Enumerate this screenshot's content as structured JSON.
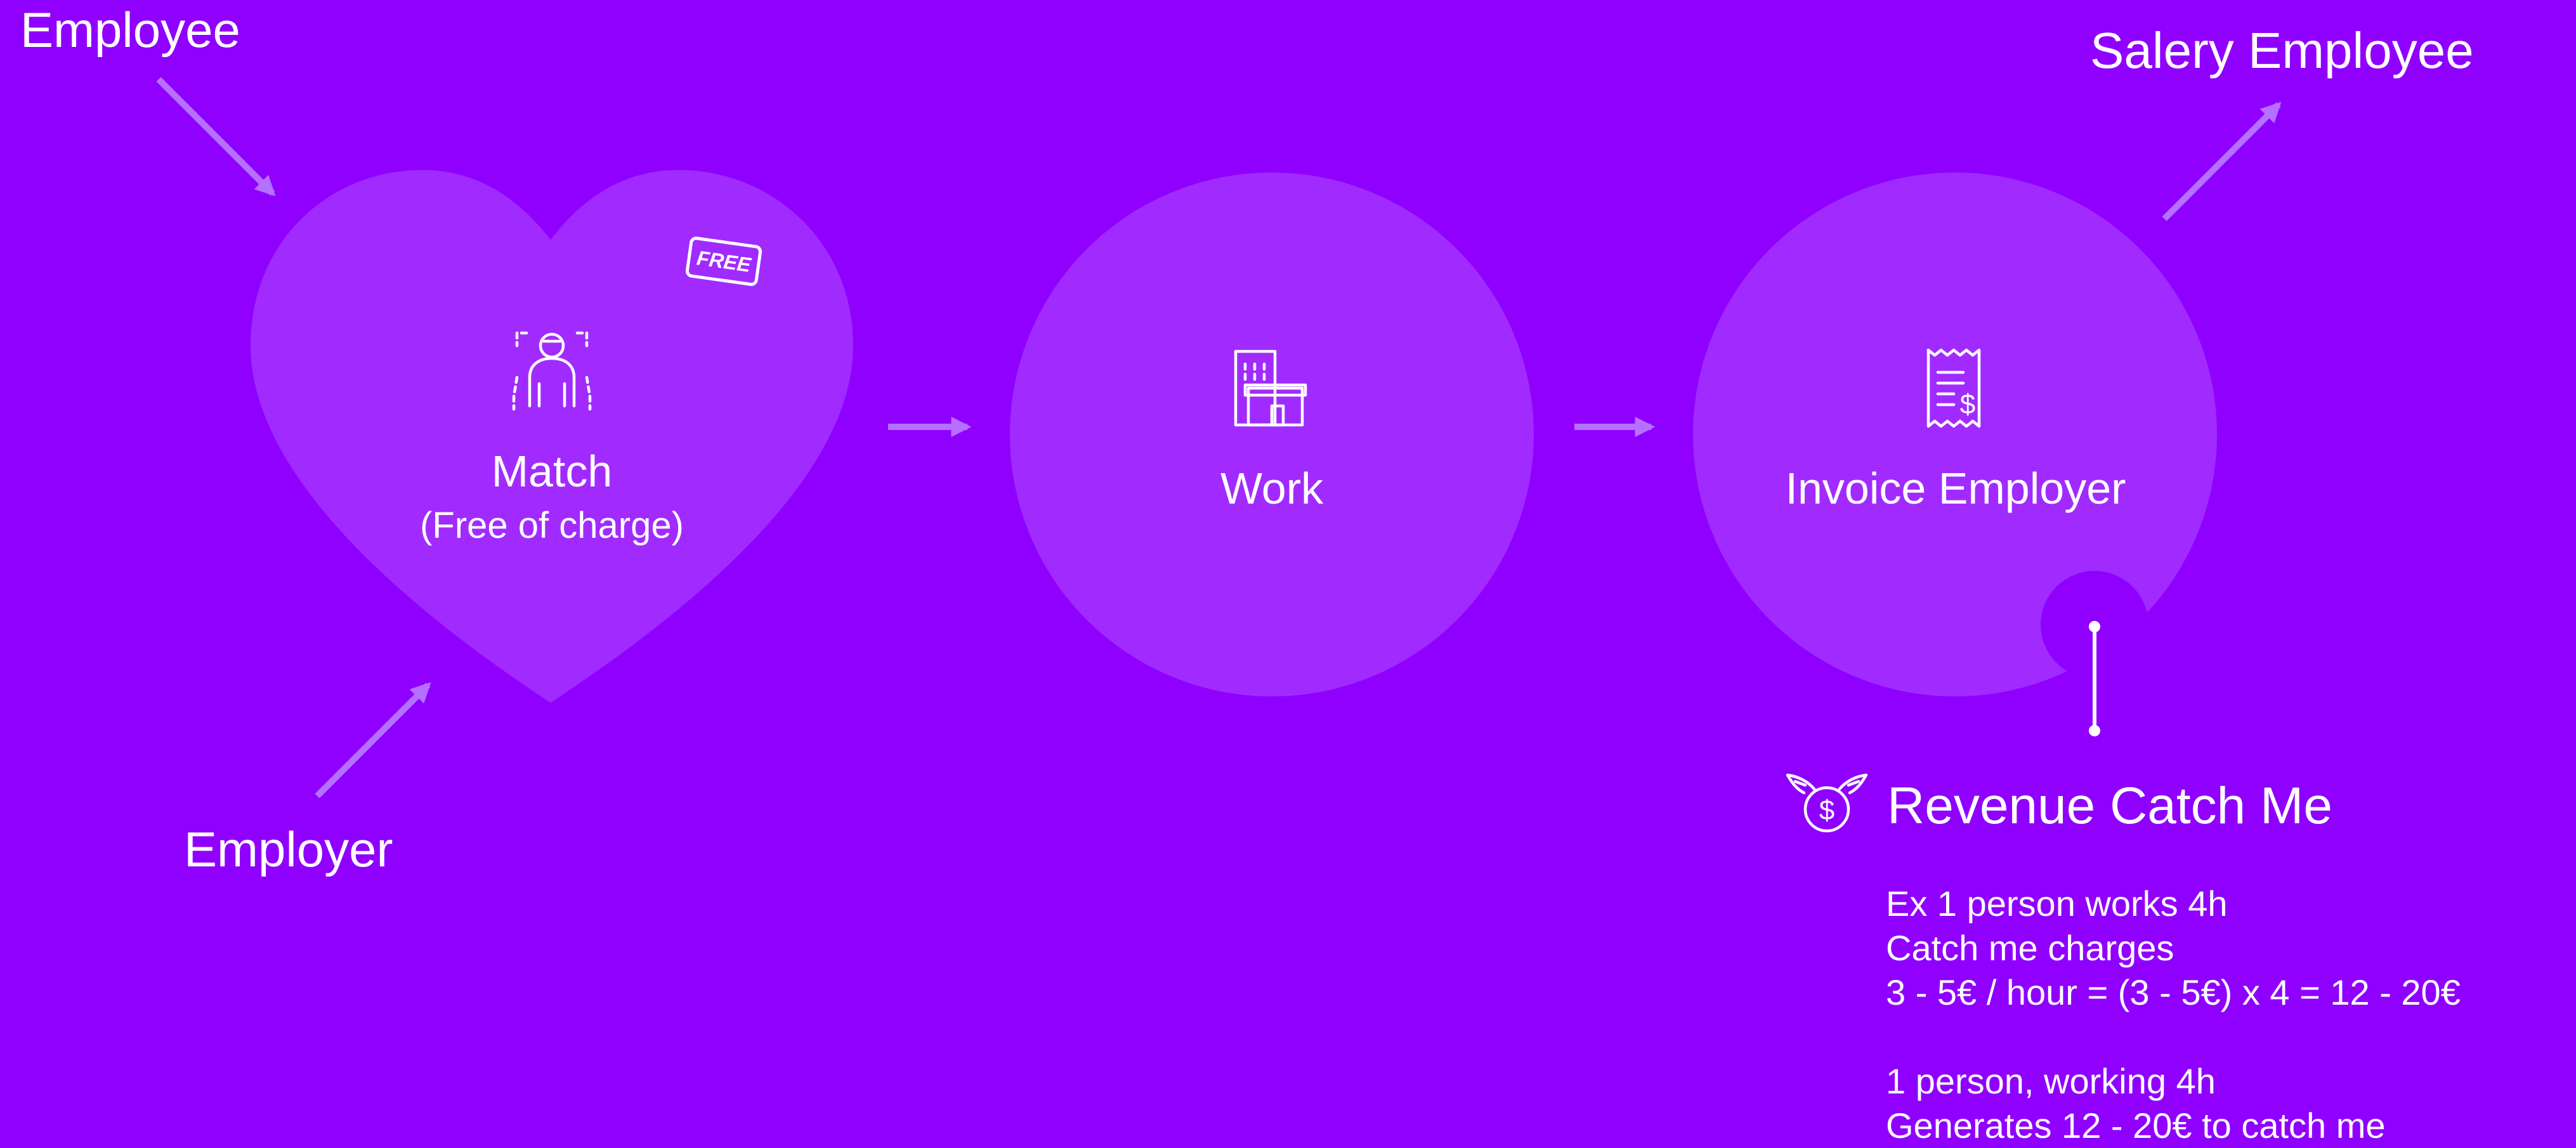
{
  "flow": {
    "input_employee": "Employee",
    "input_employer": "Employer",
    "output_salary": "Salery Employee",
    "match": {
      "title": "Match",
      "subtitle": "(Free of charge)",
      "badge": "FREE"
    },
    "work": {
      "title": "Work"
    },
    "invoice": {
      "title": "Invoice Employer"
    }
  },
  "revenue": {
    "title": "Revenue Catch Me",
    "lines": [
      "Ex 1 person works 4h",
      "Catch me charges",
      "3 - 5€ / hour = (3 - 5€) x 4 = 12 - 20€",
      "",
      "1 person, working 4h",
      "Generates 12 - 20€ to catch me"
    ]
  },
  "colors": {
    "background": "#8F00FF",
    "shape_fill": "#A12BFF",
    "arrow": "#B570FF",
    "text": "#FFFFFF"
  }
}
